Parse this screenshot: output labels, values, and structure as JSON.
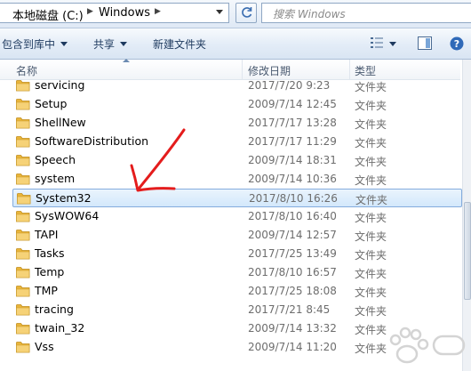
{
  "address": {
    "crumbs": [
      "本地磁盘 (C:)",
      "Windows"
    ],
    "search_placeholder": "搜索 Windows"
  },
  "toolbar": {
    "include_library": "包含到库中",
    "share": "共享",
    "new_folder": "新建文件夹"
  },
  "columns": {
    "name": "名称",
    "date": "修改日期",
    "type": "类型"
  },
  "rows": [
    {
      "name": "servicing",
      "date": "2017/7/20 9:23",
      "type": "文件夹"
    },
    {
      "name": "Setup",
      "date": "2009/7/14 12:45",
      "type": "文件夹"
    },
    {
      "name": "ShellNew",
      "date": "2017/7/17 13:28",
      "type": "文件夹"
    },
    {
      "name": "SoftwareDistribution",
      "date": "2017/7/17 11:29",
      "type": "文件夹"
    },
    {
      "name": "Speech",
      "date": "2009/7/14 18:31",
      "type": "文件夹"
    },
    {
      "name": "system",
      "date": "2009/7/14 10:36",
      "type": "文件夹"
    },
    {
      "name": "System32",
      "date": "2017/8/10 16:26",
      "type": "文件夹"
    },
    {
      "name": "SysWOW64",
      "date": "2017/8/10 16:40",
      "type": "文件夹"
    },
    {
      "name": "TAPI",
      "date": "2009/7/14 12:57",
      "type": "文件夹"
    },
    {
      "name": "Tasks",
      "date": "2017/7/25 13:49",
      "type": "文件夹"
    },
    {
      "name": "Temp",
      "date": "2017/8/10 16:57",
      "type": "文件夹"
    },
    {
      "name": "TMP",
      "date": "2017/7/25 18:08",
      "type": "文件夹"
    },
    {
      "name": "tracing",
      "date": "2017/7/21 8:45",
      "type": "文件夹"
    },
    {
      "name": "twain_32",
      "date": "2009/7/14 13:32",
      "type": "文件夹"
    },
    {
      "name": "Vss",
      "date": "2009/7/14 11:20",
      "type": "文件夹"
    }
  ],
  "selected_row": 6,
  "colors": {
    "selection": "#d3e8fb",
    "folder": "#f0c34e",
    "annotation_arrow": "#e41c1c"
  }
}
